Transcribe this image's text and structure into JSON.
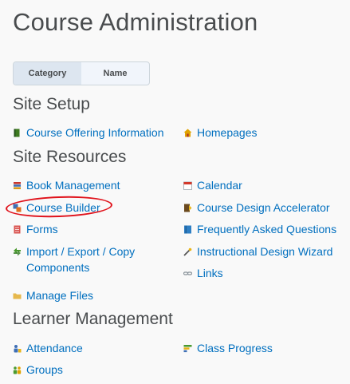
{
  "page": {
    "title": "Course Administration"
  },
  "view_toggle": {
    "options": [
      "Category",
      "Name"
    ],
    "selected": "Category"
  },
  "sections": {
    "site_setup": {
      "heading": "Site Setup",
      "items": [
        {
          "label": "Course Offering Information",
          "icon": "book-green-icon"
        },
        {
          "label": "Homepages",
          "icon": "home-icon"
        }
      ]
    },
    "site_resources": {
      "heading": "Site Resources",
      "items": [
        {
          "label": "Book Management",
          "icon": "books-icon"
        },
        {
          "label": "Calendar",
          "icon": "calendar-icon"
        },
        {
          "label": "Course Builder",
          "icon": "course-builder-icon"
        },
        {
          "label": "Course Design Accelerator",
          "icon": "accelerator-icon"
        },
        {
          "label": "Forms",
          "icon": "forms-icon"
        },
        {
          "label": "Frequently Asked Questions",
          "icon": "faq-icon"
        },
        {
          "label": "Import / Export / Copy Components",
          "icon": "import-export-icon"
        },
        {
          "label": "Instructional Design Wizard",
          "icon": "wand-icon"
        },
        {
          "label": "Links",
          "icon": "link-icon"
        },
        {
          "label": "Manage Files",
          "icon": "folder-icon"
        }
      ]
    },
    "learner_management": {
      "heading": "Learner Management",
      "items": [
        {
          "label": "Attendance",
          "icon": "attendance-icon"
        },
        {
          "label": "Class Progress",
          "icon": "progress-icon"
        },
        {
          "label": "Groups",
          "icon": "groups-icon"
        }
      ]
    }
  },
  "colors": {
    "link": "#006fbf",
    "heading": "#494c4e",
    "highlight": "#e0121b"
  }
}
